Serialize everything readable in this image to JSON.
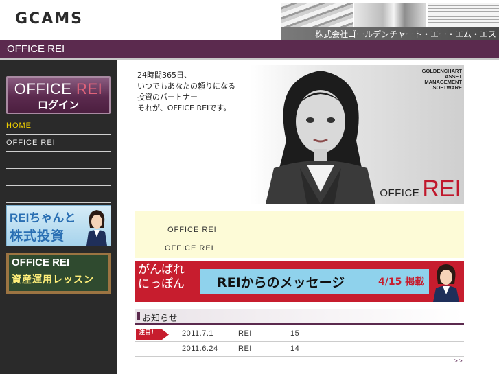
{
  "header": {
    "logo": "GCAMS",
    "company_name": "株式会社ゴールデンチャート・エー・エム・エス"
  },
  "title_bar": {
    "title": "OFFICE REI"
  },
  "sidebar": {
    "login": {
      "brand_office": "OFFICE",
      "brand_rei": " REI",
      "label": "ログイン"
    },
    "nav": [
      {
        "label": "HOME"
      },
      {
        "label": "OFFICE REI"
      },
      {
        "label": ""
      },
      {
        "label": ""
      },
      {
        "label": ""
      }
    ],
    "banner_stock": {
      "line1": "REIちゃんと",
      "line2": "株式投資"
    },
    "banner_lesson": {
      "line1": "OFFICE REI",
      "line2": "資産運用レッスン"
    }
  },
  "hero": {
    "lines": [
      "24時間365日、",
      "いつでもあなたの頼りになる",
      "投資のパートナー",
      "それが、OFFICE REIです。"
    ],
    "corp": [
      "GOLDENCHART",
      "ASSET",
      "MANAGEMENT",
      "SOFTWARE"
    ],
    "brand_office": "OFFICE",
    "brand_rei": "REI"
  },
  "info": {
    "line1": "OFFICE REI",
    "line2": "OFFICE REI"
  },
  "message_banner": {
    "left_line1": "がんばれ",
    "left_line2": "にっぽん",
    "main": "REIからのメッセージ",
    "date": "4/15 掲載"
  },
  "news": {
    "title": "お知らせ",
    "badge": "注目!",
    "items": [
      {
        "date": "2011.7.1",
        "category": "REI",
        "text": "15"
      },
      {
        "date": "2011.6.24",
        "category": "REI",
        "text": "14"
      }
    ],
    "more": ">>"
  },
  "colors": {
    "brand_purple": "#5b2a4e",
    "accent_red": "#c71d2e",
    "home_yellow": "#f4d400",
    "info_bg": "#fdfbd7"
  }
}
